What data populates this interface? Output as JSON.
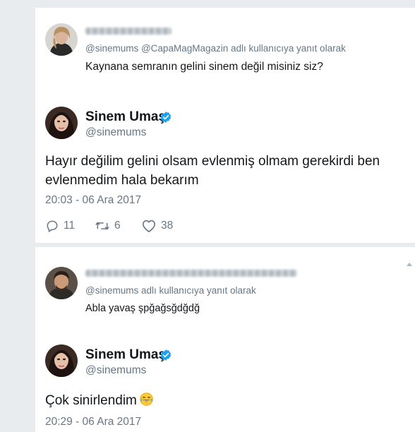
{
  "thread": [
    {
      "reply": {
        "author_name": "",
        "reply_to_text": "@sinemums @CapaMagMagazin adlı kullanıcıya yanıt olarak",
        "text": "Kaynana semranın gelini sinem değil misiniz siz?"
      },
      "tweet": {
        "author_name": "Sinem Umaş",
        "handle": "@sinemums",
        "verified": true,
        "text": "Hayır değilim gelini olsam evlenmiş olmam gerekirdi ben evlenmedim hala bekarım",
        "timestamp": "20:03 - 06 Ara 2017",
        "reply_count": "11",
        "retweet_count": "6",
        "like_count": "38"
      }
    },
    {
      "reply": {
        "author_name": "",
        "reply_to_text": "@sinemums adlı kullanıcıya yanıt olarak",
        "text": "Abla yavaş şpğağsğdğdğ"
      },
      "tweet": {
        "author_name": "Sinem Umaş",
        "handle": "@sinemums",
        "verified": true,
        "text": "Çok sinirlendim",
        "emoji": "face-with-tears-of-joy",
        "timestamp": "20:29 - 06 Ara 2017"
      }
    }
  ],
  "icons": {
    "reply": "reply-icon",
    "retweet": "retweet-icon",
    "like": "heart-icon",
    "verified": "verified-badge-icon"
  },
  "colors": {
    "verified": "#1da1f2",
    "secondary_text": "#657786",
    "primary_text": "#14171a"
  }
}
